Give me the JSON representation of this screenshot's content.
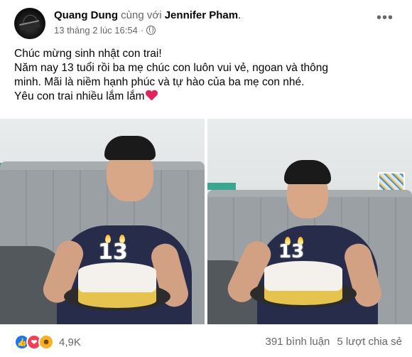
{
  "post": {
    "author": "Quang Dung",
    "with_text": "cùng với",
    "tagged": "Jennifer Pham",
    "period": ".",
    "timestamp": "13 tháng 2 lúc 16:54",
    "dot": "·",
    "more": "•••",
    "lines": [
      "Chúc mừng sinh nhật con trai!",
      "Năm nay 13 tuổi rồi ba mẹ chúc con luôn vui vẻ, ngoan và thông",
      "minh.  Mãi là niềm hạnh phúc và tự hào của ba mẹ con nhé.",
      "Yêu con trai nhiều lắm lắm"
    ],
    "emoji": "heart-icon"
  },
  "photos": [
    {
      "candle_number": "13",
      "icon": "birthday-photo-left"
    },
    {
      "candle_number": "13",
      "icon": "birthday-photo-right"
    }
  ],
  "footer": {
    "reaction_icons": [
      "like-icon",
      "love-icon",
      "haha-icon"
    ],
    "reaction_count": "4,9K",
    "comments": "391 bình luận",
    "shares": "5 lượt chia sẻ"
  },
  "colors": {
    "text_primary": "#050505",
    "text_secondary": "#65676b",
    "like": "#1877f2",
    "love": "#f33e58",
    "haha": "#f7b125",
    "heart": "#e0245e"
  }
}
